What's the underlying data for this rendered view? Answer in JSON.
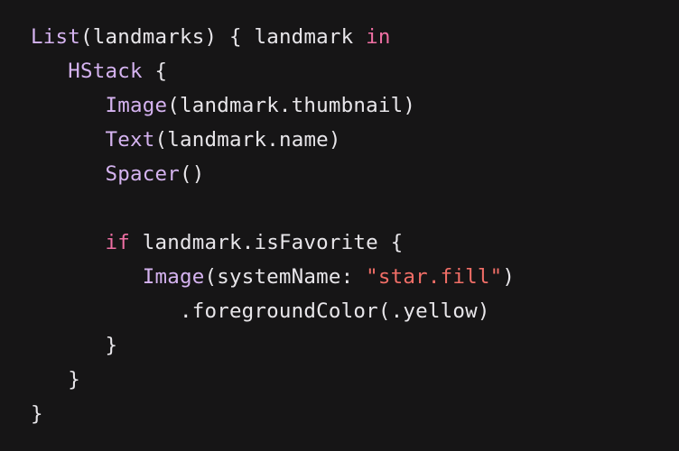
{
  "editor": {
    "colors": {
      "background": "#161516",
      "plain": "#e8e6ea",
      "type": "#d5b3f0",
      "keyword": "#ef6fa3",
      "string": "#f16e67"
    },
    "lines": [
      [
        {
          "text": "List",
          "kind": "type"
        },
        {
          "text": "(landmarks) { landmark ",
          "kind": "plain"
        },
        {
          "text": "in",
          "kind": "keyword"
        }
      ],
      [
        {
          "text": "   ",
          "kind": "plain"
        },
        {
          "text": "HStack",
          "kind": "type"
        },
        {
          "text": " {",
          "kind": "plain"
        }
      ],
      [
        {
          "text": "      ",
          "kind": "plain"
        },
        {
          "text": "Image",
          "kind": "type"
        },
        {
          "text": "(landmark.thumbnail)",
          "kind": "plain"
        }
      ],
      [
        {
          "text": "      ",
          "kind": "plain"
        },
        {
          "text": "Text",
          "kind": "type"
        },
        {
          "text": "(landmark.name)",
          "kind": "plain"
        }
      ],
      [
        {
          "text": "      ",
          "kind": "plain"
        },
        {
          "text": "Spacer",
          "kind": "type"
        },
        {
          "text": "()",
          "kind": "plain"
        }
      ],
      [],
      [
        {
          "text": "      ",
          "kind": "plain"
        },
        {
          "text": "if",
          "kind": "keyword"
        },
        {
          "text": " landmark.isFavorite {",
          "kind": "plain"
        }
      ],
      [
        {
          "text": "         ",
          "kind": "plain"
        },
        {
          "text": "Image",
          "kind": "type"
        },
        {
          "text": "(systemName: ",
          "kind": "plain"
        },
        {
          "text": "\"star.fill\"",
          "kind": "string"
        },
        {
          "text": ")",
          "kind": "plain"
        }
      ],
      [
        {
          "text": "            .foregroundColor(.yellow)",
          "kind": "plain"
        }
      ],
      [
        {
          "text": "      }",
          "kind": "plain"
        }
      ],
      [
        {
          "text": "   }",
          "kind": "plain"
        }
      ],
      [
        {
          "text": "}",
          "kind": "plain"
        }
      ]
    ]
  }
}
